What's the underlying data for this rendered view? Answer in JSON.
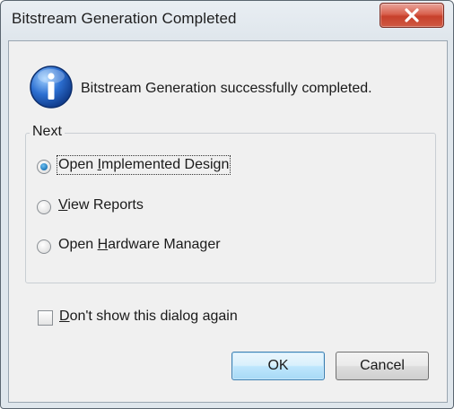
{
  "window": {
    "title": "Bitstream Generation Completed",
    "close_icon": "close-x-icon"
  },
  "message": {
    "icon": "info-icon",
    "text": "Bitstream Generation successfully completed."
  },
  "next_group": {
    "legend": "Next",
    "options": [
      {
        "pre": "Open ",
        "mnemonic": "I",
        "post": "mplemented Design",
        "selected": true
      },
      {
        "pre": "",
        "mnemonic": "V",
        "post": "iew Reports",
        "selected": false
      },
      {
        "pre": "Open ",
        "mnemonic": "H",
        "post": "ardware Manager",
        "selected": false
      }
    ]
  },
  "dont_show": {
    "pre": "",
    "mnemonic": "D",
    "post": "on't show this dialog again",
    "checked": false
  },
  "buttons": {
    "ok_label": "OK",
    "cancel_label": "Cancel"
  },
  "colors": {
    "accent": "#1f78b9",
    "close_red": "#c7402b"
  }
}
